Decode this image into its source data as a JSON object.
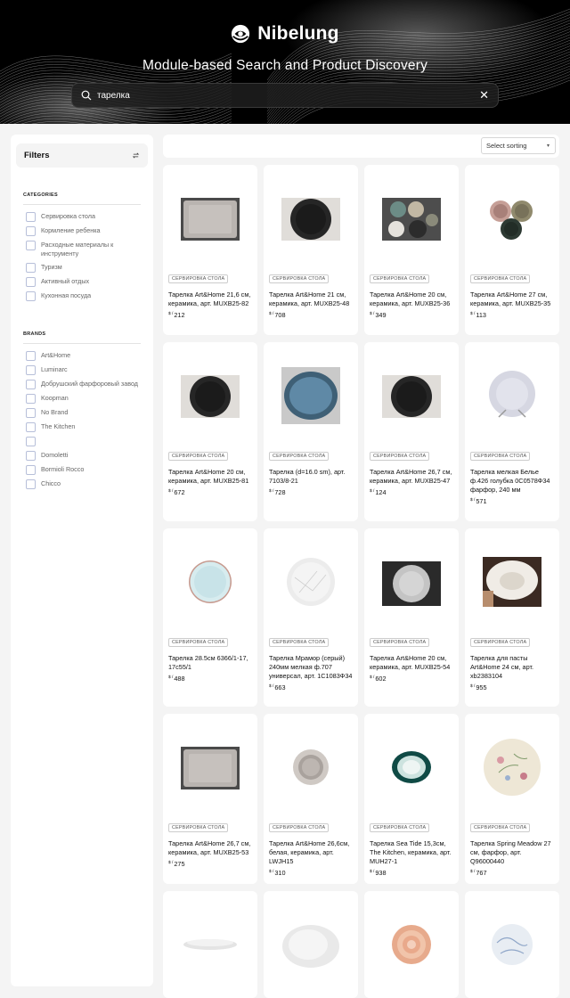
{
  "brand": {
    "name": "Nibelung"
  },
  "hero": {
    "title": "Module-based Search and Product Discovery"
  },
  "search": {
    "value": "тарелка",
    "clear": "✕"
  },
  "sidebar": {
    "title": "Filters",
    "categories_title": "CATEGORIES",
    "categories": [
      "Сервировка стола",
      "Кормление ребенка",
      "Расходные материалы к инструменту",
      "Туризм",
      "Активный отдых",
      "Кухонная посуда"
    ],
    "brands_title": "BRANDS",
    "brands": [
      "Art&Home",
      "Luminarc",
      "Добрушский фарфоровый завод",
      "Koopman",
      "No Brand",
      "The Kitchen",
      "",
      "Domoletti",
      "Bormioli Rocco",
      "Chicco"
    ]
  },
  "sort": {
    "label": "Select sorting",
    "caret": "▾"
  },
  "currency": "$ /",
  "products": [
    {
      "category": "СЕРВИРОВКА СТОЛА",
      "title": "Тарелка Art&Home 21,6 см, керамика, арт. MUXB25-82",
      "price": "212",
      "image": "grey-square-plate"
    },
    {
      "category": "СЕРВИРОВКА СТОЛА",
      "title": "Тарелка Art&Home 21 см, керамика, арт. MUXB25-48",
      "price": "708",
      "image": "black-plate"
    },
    {
      "category": "СЕРВИРОВКА СТОЛА",
      "title": "Тарелка Art&Home 20 см, керамика, арт. MUXB25-36",
      "price": "349",
      "image": "plate-set"
    },
    {
      "category": "СЕРВИРОВКА СТОЛА",
      "title": "Тарелка Art&Home 27 см, керамика, арт. MUXB25-35",
      "price": "113",
      "image": "three-plates"
    },
    {
      "category": "СЕРВИРОВКА СТОЛА",
      "title": "Тарелка Art&Home 20 см, керамика, арт. MUXB25-81",
      "price": "672",
      "image": "black-plate"
    },
    {
      "category": "СЕРВИРОВКА СТОЛА",
      "title": "Тарелка (d=16.0 sm), арт. 7103/8-21",
      "price": "728",
      "image": "blue-plate"
    },
    {
      "category": "СЕРВИРОВКА СТОЛА",
      "title": "Тарелка Art&Home 26,7 см, керамика, арт. MUXB25-47",
      "price": "124",
      "image": "black-plate"
    },
    {
      "category": "СЕРВИРОВКА СТОЛА",
      "title": "Тарелка мелкая Белье ф.426 голубка 0С0578Ф34 фарфор, 240 мм",
      "price": "571",
      "image": "white-plate-stand"
    },
    {
      "category": "СЕРВИРОВКА СТОЛА",
      "title": "Тарелка 28.5см 6366/1-17, 17с55/1",
      "price": "488",
      "image": "speckled-plate"
    },
    {
      "category": "СЕРВИРОВКА СТОЛА",
      "title": "Тарелка Мрамор (серый) 240мм мелкая ф.707 универсал, арт. 1С1083Ф34",
      "price": "663",
      "image": "marble-plate"
    },
    {
      "category": "СЕРВИРОВКА СТОЛА",
      "title": "Тарелка Art&Home 20 см, керамика, арт. MUXB25-54",
      "price": "602",
      "image": "light-plate-dark-bg"
    },
    {
      "category": "СЕРВИРОВКА СТОЛА",
      "title": "Тарелка для пасты Art&Home 24 см, арт. xb2383104",
      "price": "955",
      "image": "pasta-plate"
    },
    {
      "category": "СЕРВИРОВКА СТОЛА",
      "title": "Тарелка Art&Home 26,7 см, керамика, арт. MUXB25-53",
      "price": "275",
      "image": "grey-square-plate"
    },
    {
      "category": "СЕРВИРОВКА СТОЛА",
      "title": "Тарелка Art&Home 26,6см, белая, керамика, арт. LWJH15",
      "price": "310",
      "image": "bowl-plate"
    },
    {
      "category": "СЕРВИРОВКА СТОЛА",
      "title": "Тарелка Sea Tide 15,3см, The Kitchen, керамика, арт. MUH27-1",
      "price": "938",
      "image": "green-rim-plate"
    },
    {
      "category": "СЕРВИРОВКА СТОЛА",
      "title": "Тарелка Spring Meadow 27 см, фарфор, арт. Q96000440",
      "price": "767",
      "image": "floral-plate"
    },
    {
      "category": "",
      "title": "",
      "price": "",
      "image": "flat-white-plate"
    },
    {
      "category": "",
      "title": "",
      "price": "",
      "image": "white-deep-plate"
    },
    {
      "category": "",
      "title": "",
      "price": "",
      "image": "orange-plate"
    },
    {
      "category": "",
      "title": "",
      "price": "",
      "image": "blue-pattern-plate"
    }
  ]
}
